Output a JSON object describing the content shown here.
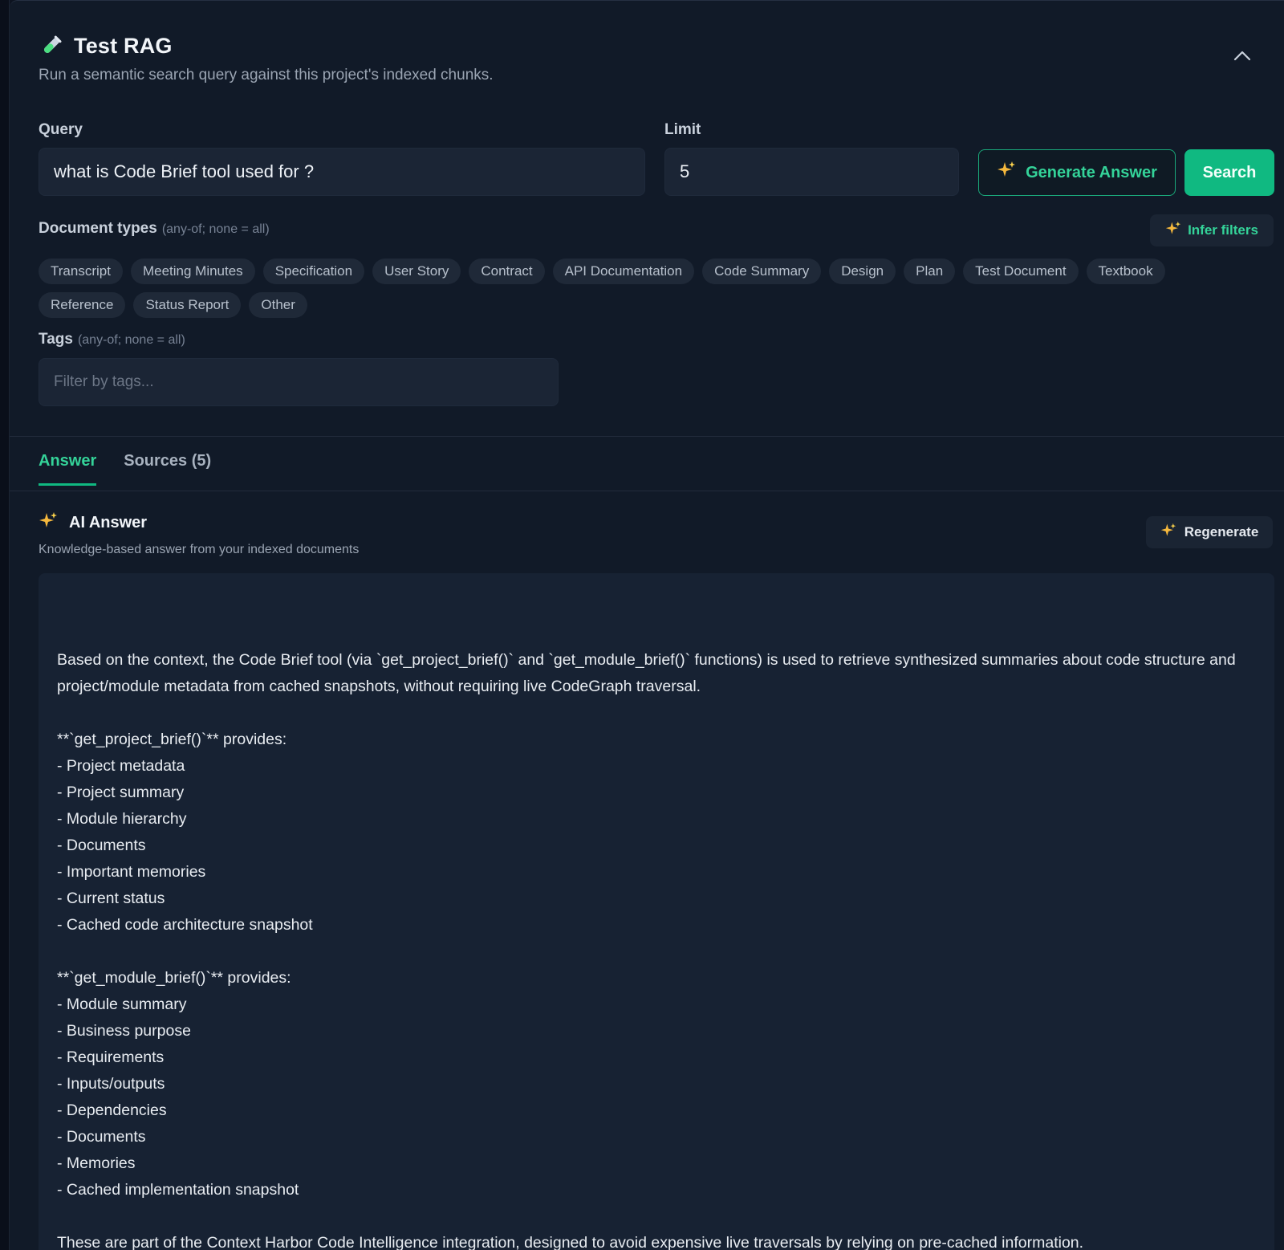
{
  "header": {
    "title": "Test RAG",
    "subtitle": "Run a semantic search query against this project's indexed chunks.",
    "icon": "test-tube-icon"
  },
  "query": {
    "label": "Query",
    "value": "what is Code Brief tool used for ?"
  },
  "limit": {
    "label": "Limit",
    "value": "5"
  },
  "actions": {
    "generate_label": "Generate Answer",
    "search_label": "Search",
    "infer_label": "Infer filters",
    "regenerate_label": "Regenerate"
  },
  "doc_types": {
    "label": "Document types",
    "hint": "(any-of; none = all)",
    "items": [
      "Transcript",
      "Meeting Minutes",
      "Specification",
      "User Story",
      "Contract",
      "API Documentation",
      "Code Summary",
      "Design",
      "Plan",
      "Test Document",
      "Textbook",
      "Reference",
      "Status Report",
      "Other"
    ]
  },
  "tags": {
    "label": "Tags",
    "hint": "(any-of; none = all)",
    "placeholder": "Filter by tags..."
  },
  "tabs": {
    "answer": "Answer",
    "sources": "Sources (5)"
  },
  "ai_answer": {
    "title": "AI Answer",
    "subtitle": "Knowledge-based answer from your indexed documents",
    "paragraphs": [
      [
        "Based on the context, the Code Brief tool (via `get_project_brief()` and `get_module_brief()` functions) is used to retrieve synthesized summaries about code structure and project/module metadata from cached snapshots, without requiring live CodeGraph traversal."
      ],
      [
        "**`get_project_brief()`** provides:",
        "- Project metadata",
        "- Project summary",
        "- Module hierarchy",
        "- Documents",
        "- Important memories",
        "- Current status",
        "- Cached code architecture snapshot"
      ],
      [
        "**`get_module_brief()`** provides:",
        "- Module summary",
        "- Business purpose",
        "- Requirements",
        "- Inputs/outputs",
        "- Dependencies",
        "- Documents",
        "- Memories",
        "- Cached implementation snapshot"
      ],
      [
        "These are part of the Context Harbor Code Intelligence integration, designed to avoid expensive live traversals by relying on pre-cached information."
      ]
    ]
  },
  "colors": {
    "accent": "#10b981",
    "accent_text": "#34d399",
    "background": "#111a28",
    "sparkle": "#f5b83d"
  }
}
